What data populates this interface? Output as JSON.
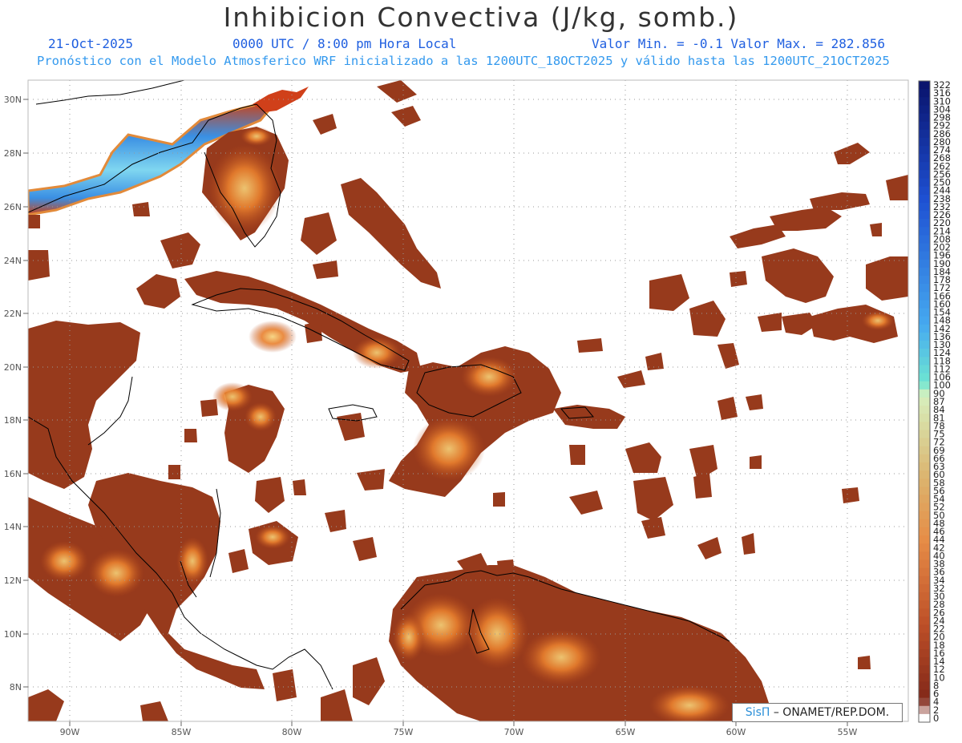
{
  "header": {
    "title": "Inhibicion Convectiva (J/kg, somb.)",
    "date": "21-Oct-2025",
    "time": "0000 UTC / 8:00 pm Hora Local",
    "value_range": "Valor Min. = -0.1  Valor Max. = 282.856",
    "forecast_note": "Pronóstico con el Modelo Atmosferico WRF inicializado a las 1200UTC_18OCT2025 y válido hasta las  1200UTC_21OCT2025"
  },
  "map": {
    "lon_labels": [
      "90W",
      "85W",
      "80W",
      "75W",
      "70W",
      "65W",
      "60W",
      "55W"
    ],
    "lat_labels": [
      "30N",
      "28N",
      "26N",
      "24N",
      "22N",
      "20N",
      "18N",
      "16N",
      "14N",
      "12N",
      "10N",
      "8N"
    ],
    "fill_color": "#973a1c",
    "ocean_color": "#ffffff",
    "grid_style": "dotted"
  },
  "colorbar": {
    "labels": [
      "322",
      "316",
      "310",
      "304",
      "298",
      "292",
      "286",
      "280",
      "274",
      "268",
      "262",
      "256",
      "250",
      "244",
      "238",
      "232",
      "226",
      "220",
      "214",
      "208",
      "202",
      "196",
      "190",
      "184",
      "178",
      "172",
      "166",
      "160",
      "154",
      "148",
      "142",
      "136",
      "130",
      "124",
      "118",
      "112",
      "106",
      "100",
      "90",
      "87",
      "84",
      "81",
      "78",
      "75",
      "72",
      "69",
      "66",
      "63",
      "60",
      "58",
      "56",
      "54",
      "52",
      "50",
      "48",
      "46",
      "44",
      "42",
      "40",
      "38",
      "36",
      "34",
      "32",
      "30",
      "28",
      "26",
      "24",
      "22",
      "20",
      "18",
      "16",
      "14",
      "12",
      "10",
      "8",
      "6",
      "4",
      "2",
      "0"
    ]
  },
  "credit": {
    "brand": "SisΠ",
    "text": " – ONAMET/REP.DOM."
  }
}
